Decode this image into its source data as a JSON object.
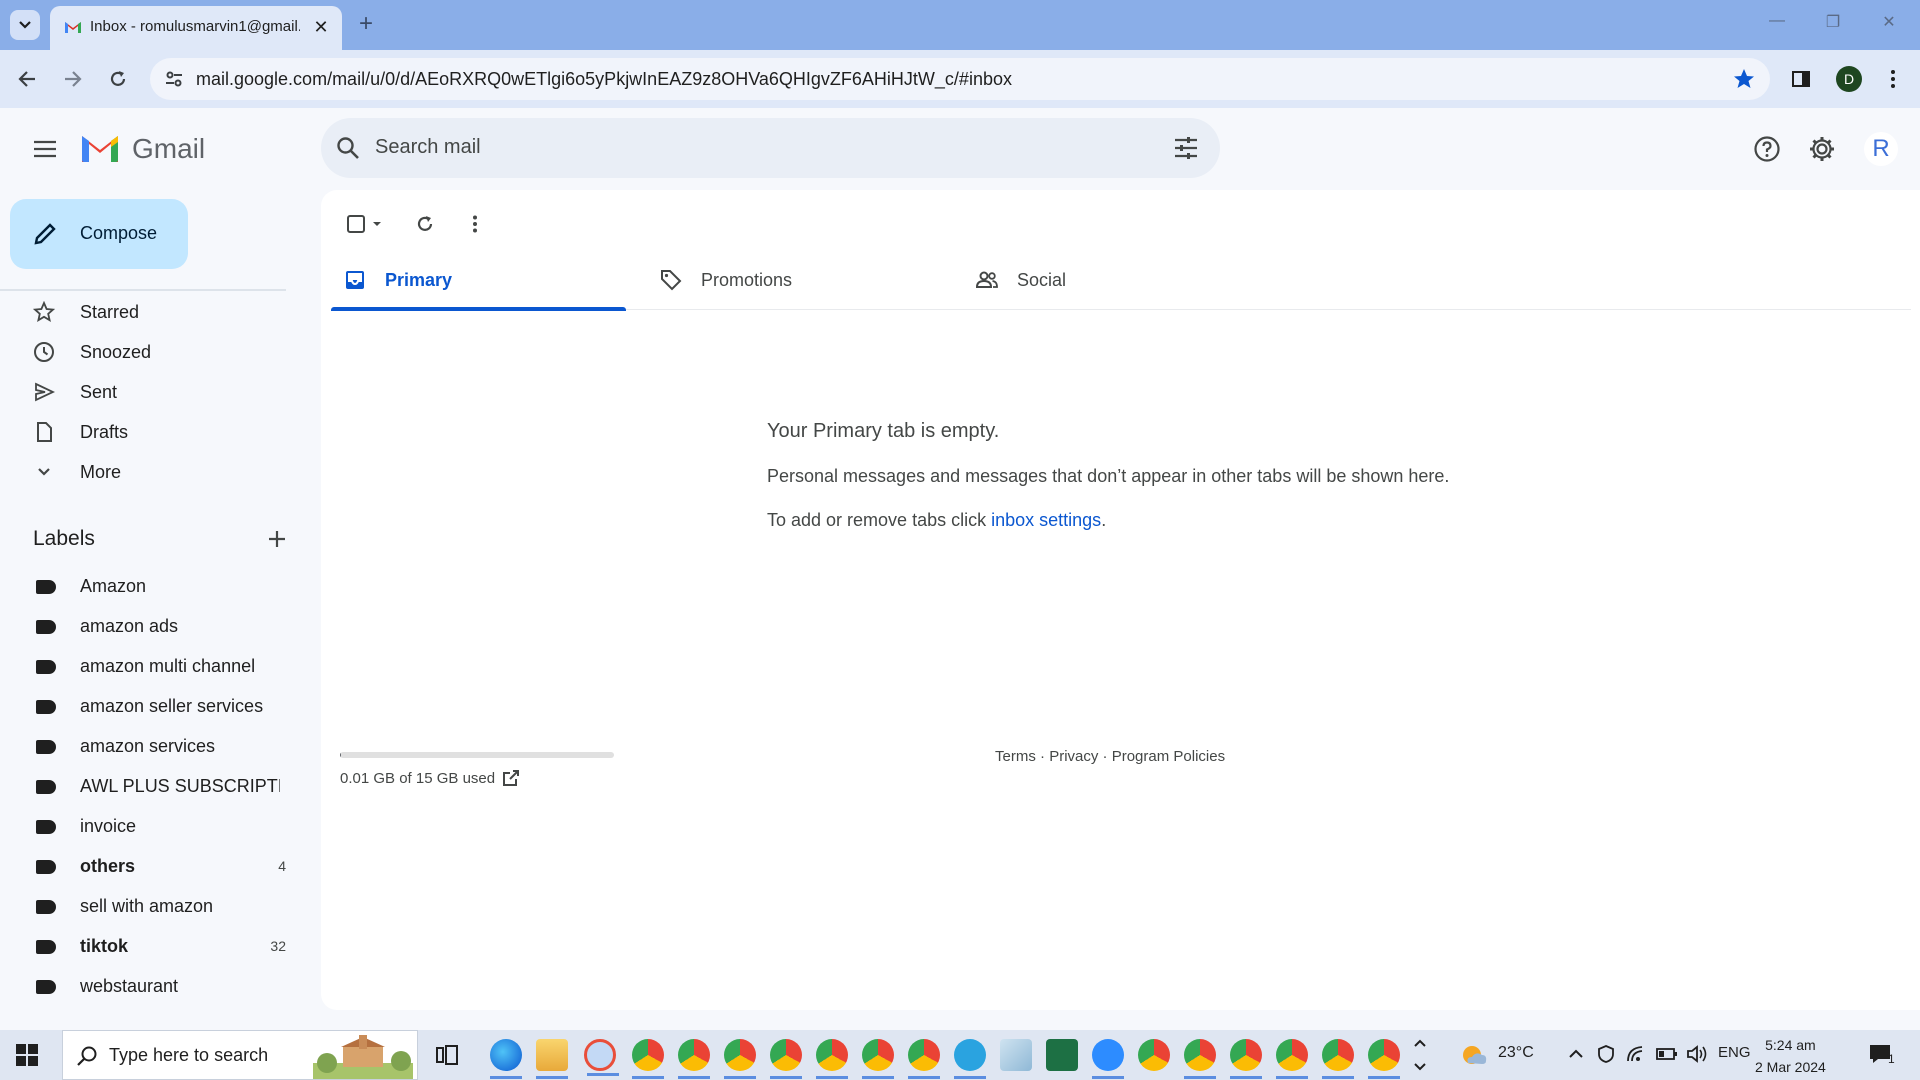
{
  "browser": {
    "tab_title": "Inbox - romulusmarvin1@gmail.com - Gmail",
    "url": "mail.google.com/mail/u/0/d/AEoRXRQ0wETlgi6o5yPkjwInEAZ9z8OHVa6QHIgvZF6AHiHJtW_c/#inbox",
    "profile_initial": "D"
  },
  "gmail": {
    "app_name": "Gmail",
    "search_placeholder": "Search mail",
    "avatar_initial": "R",
    "compose_label": "Compose",
    "nav": [
      {
        "label": "Starred",
        "icon": "star-icon"
      },
      {
        "label": "Snoozed",
        "icon": "clock-icon"
      },
      {
        "label": "Sent",
        "icon": "send-icon"
      },
      {
        "label": "Drafts",
        "icon": "draft-icon"
      },
      {
        "label": "More",
        "icon": "chevron-down-icon"
      }
    ],
    "labels_heading": "Labels",
    "labels": [
      {
        "label": "Amazon",
        "count": "",
        "bold": false
      },
      {
        "label": "amazon ads",
        "count": "",
        "bold": false
      },
      {
        "label": "amazon multi channel",
        "count": "",
        "bold": false
      },
      {
        "label": "amazon seller services",
        "count": "",
        "bold": false
      },
      {
        "label": "amazon services",
        "count": "",
        "bold": false
      },
      {
        "label": "AWL PLUS SUBSCRIPTI...",
        "count": "",
        "bold": false
      },
      {
        "label": "invoice",
        "count": "",
        "bold": false
      },
      {
        "label": "others",
        "count": "4",
        "bold": true
      },
      {
        "label": "sell with amazon",
        "count": "",
        "bold": false
      },
      {
        "label": "tiktok",
        "count": "32",
        "bold": true
      },
      {
        "label": "webstaurant",
        "count": "",
        "bold": false
      }
    ],
    "tabs": [
      {
        "label": "Primary",
        "active": true
      },
      {
        "label": "Promotions",
        "active": false
      },
      {
        "label": "Social",
        "active": false
      }
    ],
    "empty": {
      "title": "Your Primary tab is empty.",
      "body": "Personal messages and messages that don’t appear in other tabs will be shown here.",
      "settings_prefix": "To add or remove tabs click ",
      "settings_link": "inbox settings",
      "settings_suffix": "."
    },
    "storage": {
      "text": "0.01 GB of 15 GB used",
      "fraction": 0.001
    },
    "footer": {
      "terms": "Terms",
      "privacy": "Privacy",
      "policies": "Program Policies",
      "sep": " · "
    }
  },
  "taskbar": {
    "search_placeholder": "Type here to search",
    "weather": "23°C",
    "lang": "ENG",
    "time": "5:24 am",
    "date": "2 Mar 2024",
    "notification_count": "1"
  },
  "colors": {
    "accent": "#0b57d0",
    "compose_bg": "#c2e7ff",
    "tabbar_bg": "#8aaee8"
  }
}
